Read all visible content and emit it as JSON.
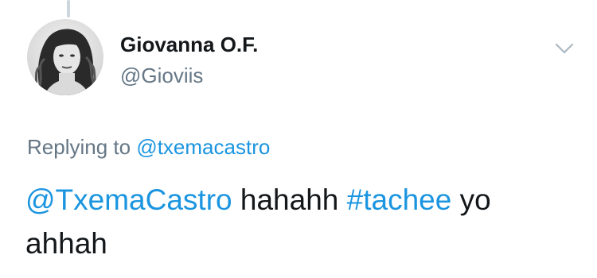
{
  "tweet": {
    "author": {
      "display_name": "Giovanna O.F.",
      "handle": "@Gioviis",
      "avatar_icon": "profile-photo"
    },
    "caret_icon": "chevron-down-icon",
    "reply_context": {
      "prefix": "Replying to",
      "mention": "@txemacastro"
    },
    "text": {
      "mention": "@TxemaCastro",
      "part1": "hahahh",
      "hashtag": "#tachee",
      "part2": "yo ahhah"
    }
  },
  "colors": {
    "link": "#1b95e0",
    "secondary_text": "#657786",
    "primary_text": "#14171a",
    "thread_line": "#ccd6dd"
  }
}
